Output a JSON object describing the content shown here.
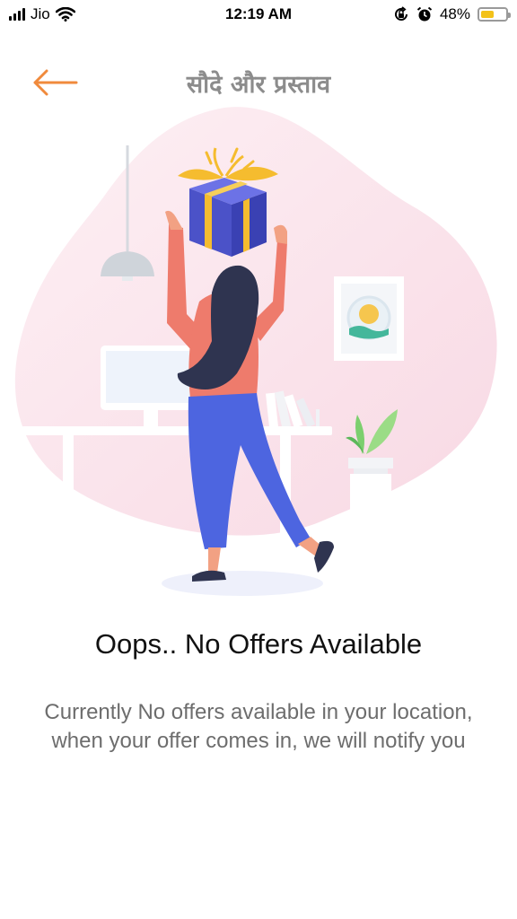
{
  "status_bar": {
    "carrier": "Jio",
    "time": "12:19 AM",
    "battery_percent": "48%",
    "battery_level": 0.48,
    "icons": [
      "signal-bars-icon",
      "wifi-icon",
      "orientation-lock-icon",
      "alarm-icon",
      "battery-icon"
    ]
  },
  "header": {
    "back_icon": "back-arrow-icon",
    "title": "सौदे और प्रस्ताव"
  },
  "empty_state": {
    "title": "Oops.. No Offers Available",
    "message": "Currently No offers available in your location, when your offer comes in, we will notify you"
  },
  "colors": {
    "accent": "#f08a3c",
    "title_gray": "#8c8c8c",
    "message_gray": "#6d6d6d",
    "blob_pink": "#fbe6ee",
    "gift_blue": "#4b52c8",
    "ribbon_gold": "#f5bc2f",
    "shirt": "#ee7b6c",
    "pants": "#4d65e0",
    "hair": "#2f3450"
  }
}
